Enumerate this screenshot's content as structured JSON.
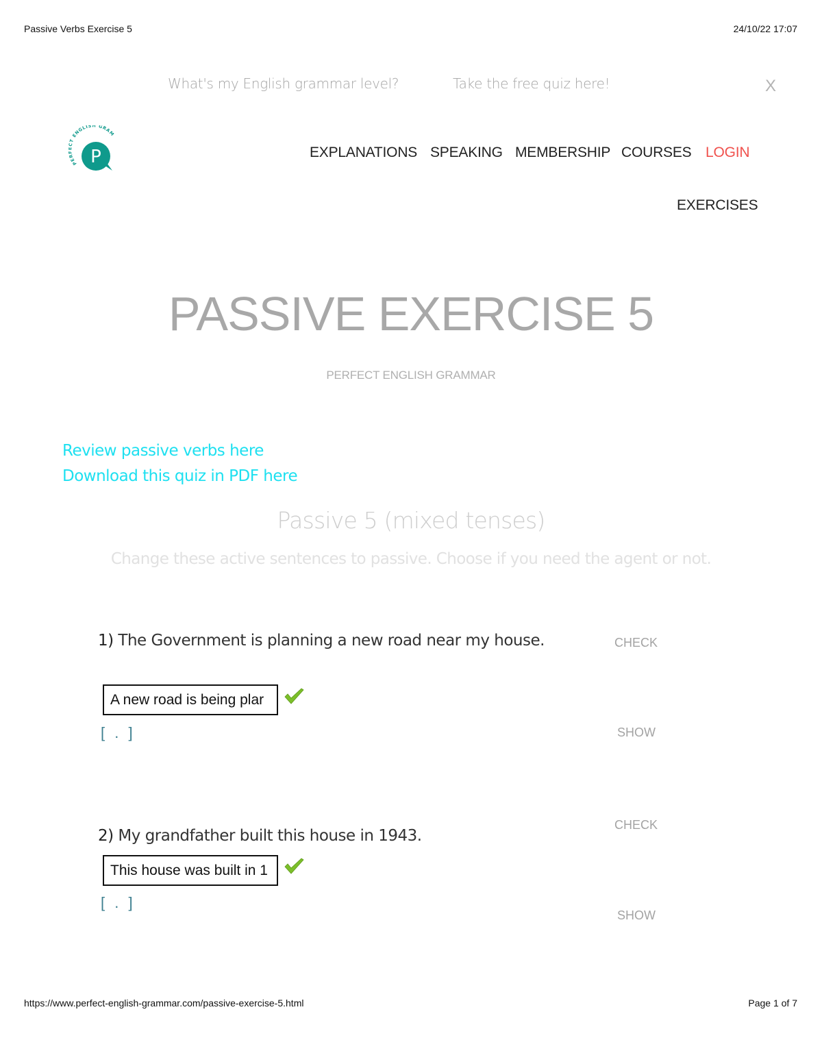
{
  "print_header": {
    "title": "Passive Verbs Exercise 5",
    "datetime": "24/10/22 17:07"
  },
  "print_footer": {
    "url": "https://www.perfect-english-grammar.com/passive-exercise-5.html",
    "page": "Page 1 of 7"
  },
  "promo": {
    "question": "What's my English grammar level?",
    "link": "Take the free quiz here!",
    "close": "X"
  },
  "logo": {
    "letter": "P",
    "ring_text": "PERFECT ENGLISH GRAMMAR",
    "color": "#0f9a8c"
  },
  "nav": {
    "items": [
      {
        "label": "EXPLANATIONS"
      },
      {
        "label": "SPEAKING"
      },
      {
        "label": "MEMBERSHIP"
      },
      {
        "label": "COURSES"
      },
      {
        "label": "LOGIN"
      },
      {
        "label": "EXERCISES"
      }
    ],
    "login_color": "#f0514d"
  },
  "header": {
    "title": "PASSIVE EXERCISE 5",
    "subtitle": "PERFECT ENGLISH GRAMMAR"
  },
  "links": {
    "review": "Review passive verbs here",
    "download": "Download this quiz in PDF here",
    "color": "#1ee0f0"
  },
  "quiz": {
    "title": "Passive 5 (mixed tenses)",
    "instructions": "Change these active sentences to passive. Choose if you need the agent or not.",
    "questions": [
      {
        "number": "1)",
        "text": "The Government is planning a new road near my house.",
        "answer_value": "A new road is being plar",
        "status_icon": "check-mark-icon",
        "hint": "[ . ]",
        "check_label": "CHECK",
        "show_label": "SHOW"
      },
      {
        "number": "2)",
        "text": "My grandfather built this house in 1943.",
        "answer_value": "This house was built in 1",
        "status_icon": "check-mark-icon",
        "hint": "[ . ]",
        "check_label": "CHECK",
        "show_label": "SHOW"
      }
    ]
  }
}
